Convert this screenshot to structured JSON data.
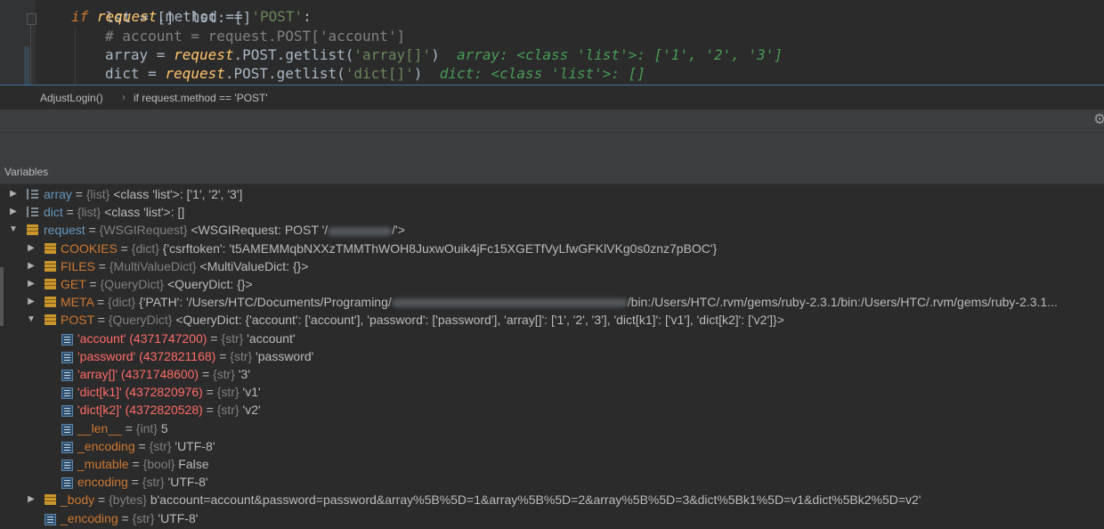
{
  "editor": {
    "line0": "lst = []  lst: []",
    "line1": {
      "kw": "if",
      "var": "request",
      "rest": ".method == ",
      "str": "'POST'",
      "colon": ":"
    },
    "line2": "# account = request.POST['account']",
    "line3": {
      "name": "array",
      "var": "request",
      "call": ".POST.getlist(",
      "str": "'array[]'",
      "close": ")",
      "inline": "array: <class 'list'>: ['1', '2', '3']"
    },
    "line4": {
      "name": "dict",
      "var": "request",
      "call": ".POST.getlist(",
      "str": "'dict[]'",
      "close": ")",
      "inline": "dict: <class 'list'>: []"
    }
  },
  "breadcrumb": {
    "item1": "AdjustLogin()",
    "separator": "›",
    "item2": "if request.method == 'POST'"
  },
  "debugger": {
    "panel_title": "Variables",
    "settings_icon": "gear-icon"
  },
  "variables": [
    {
      "name": "array",
      "eq": " = ",
      "type": "{list}",
      "value": " <class 'list'>: ['1', '2', '3']",
      "icon": "list-icon",
      "expand": "▶",
      "name_color": "blue"
    },
    {
      "name": "dict",
      "eq": " = ",
      "type": "{list}",
      "value": " <class 'list'>: []",
      "icon": "list-icon",
      "expand": "▶",
      "name_color": "blue"
    },
    {
      "name": "request",
      "eq": " = ",
      "type": "{WSGIRequest}",
      "value": " <WSGIRequest: POST '/",
      "value_tail": "/'>",
      "icon": "object-icon",
      "expand": "▼",
      "name_color": "blue"
    },
    {
      "name": "COOKIES",
      "eq": " = ",
      "type": "{dict}",
      "value": " {'csrftoken': 't5AMEMMqbNXXzTMMThWOH8JuxwOuik4jFc15XGETfVyLfwGFKlVKg0s0znz7pBOC'}",
      "icon": "object-icon",
      "expand": "▶",
      "name_color": "orange"
    },
    {
      "name": "FILES",
      "eq": " = ",
      "type": "{MultiValueDict}",
      "value": " <MultiValueDict: {}>",
      "icon": "object-icon",
      "expand": "▶",
      "name_color": "orange"
    },
    {
      "name": "GET",
      "eq": " = ",
      "type": "{QueryDict}",
      "value": " <QueryDict: {}>",
      "icon": "object-icon",
      "expand": "▶",
      "name_color": "orange"
    },
    {
      "name": "META",
      "eq": " = ",
      "type": "{dict}",
      "value": " {'PATH': '/Users/HTC/Documents/Programing/",
      "value_tail": "/bin:/Users/HTC/.rvm/gems/ruby-2.3.1/bin:/Users/HTC/.rvm/gems/ruby-2.3.1...",
      "icon": "object-icon",
      "expand": "▶",
      "name_color": "orange"
    },
    {
      "name": "POST",
      "eq": " = ",
      "type": "{QueryDict}",
      "value": " <QueryDict: {'account': ['account'], 'password': ['password'], 'array[]': ['1', '2', '3'], 'dict[k1]': ['v1'], 'dict[k2]': ['v2']}>",
      "icon": "object-icon",
      "expand": "▼",
      "name_color": "orange"
    },
    {
      "name": "'account' (4371747200)",
      "eq": " = ",
      "type": "{str}",
      "value": " 'account'",
      "icon": "string-icon",
      "expand": "",
      "name_color": "pink"
    },
    {
      "name": "'password' (4372821168)",
      "eq": " = ",
      "type": "{str}",
      "value": " 'password'",
      "icon": "string-icon",
      "expand": "",
      "name_color": "pink"
    },
    {
      "name": "'array[]' (4371748600)",
      "eq": " = ",
      "type": "{str}",
      "value": " '3'",
      "icon": "string-icon",
      "expand": "",
      "name_color": "pink"
    },
    {
      "name": "'dict[k1]' (4372820976)",
      "eq": " = ",
      "type": "{str}",
      "value": " 'v1'",
      "icon": "string-icon",
      "expand": "",
      "name_color": "pink"
    },
    {
      "name": "'dict[k2]' (4372820528)",
      "eq": " = ",
      "type": "{str}",
      "value": " 'v2'",
      "icon": "string-icon",
      "expand": "",
      "name_color": "pink"
    },
    {
      "name": "__len__",
      "eq": " = ",
      "type": "{int}",
      "value": " 5",
      "icon": "string-icon",
      "expand": "",
      "name_color": "orange"
    },
    {
      "name": "_encoding",
      "eq": " = ",
      "type": "{str}",
      "value": " 'UTF-8'",
      "icon": "string-icon",
      "expand": "",
      "name_color": "orange"
    },
    {
      "name": "_mutable",
      "eq": " = ",
      "type": "{bool}",
      "value": " False",
      "icon": "string-icon",
      "expand": "",
      "name_color": "orange"
    },
    {
      "name": "encoding",
      "eq": " = ",
      "type": "{str}",
      "value": " 'UTF-8'",
      "icon": "string-icon",
      "expand": "",
      "name_color": "orange"
    },
    {
      "name": "_body",
      "eq": " = ",
      "type": "{bytes}",
      "value": " b'account=account&password=password&array%5B%5D=1&array%5B%5D=2&array%5B%5D=3&dict%5Bk1%5D=v1&dict%5Bk2%5D=v2'",
      "icon": "object-icon",
      "expand": "▶",
      "name_color": "orange"
    },
    {
      "name": "_encoding",
      "eq": " = ",
      "type": "{str}",
      "value": " 'UTF-8'",
      "icon": "string-icon",
      "expand": "",
      "name_color": "orange"
    }
  ],
  "colors": {
    "editor_bg": "#2b2b2b",
    "panel_bg": "#3c3f41",
    "name_blue": "#6897bb",
    "name_orange": "#cc7832",
    "name_pink": "#ff6b68",
    "type_gray": "#808080"
  }
}
